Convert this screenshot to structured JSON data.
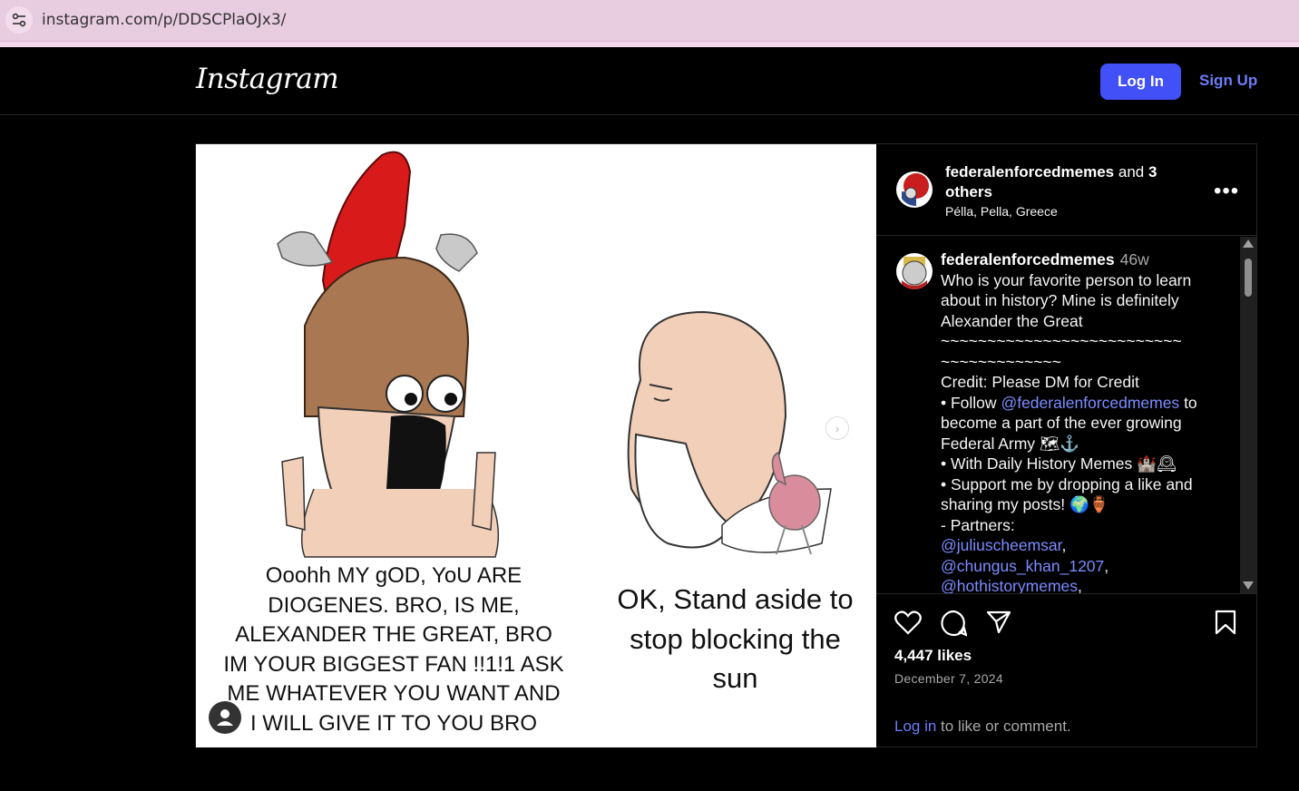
{
  "browser": {
    "url": "instagram.com/p/DDSCPlaOJx3/"
  },
  "header": {
    "logo": "Instagram",
    "login_label": "Log In",
    "signup_label": "Sign Up"
  },
  "media": {
    "caption_left": "Ooohh MY gOD, YoU ARE DIOGENES. BRO, IS ME, ALEXANDER THE GREAT, BRO IM YOUR BIGGEST FAN !!1!1 ASK ME WHATEVER YOU WANT AND I WILL GIVE IT TO YOU BRO",
    "caption_right": "OK, Stand aside to stop blocking the sun"
  },
  "post_header": {
    "username": "federalenforcedmemes",
    "and_text": "and",
    "others": "3 others",
    "location": "Pélla, Pella, Greece"
  },
  "caption": {
    "username": "federalenforcedmemes",
    "time_ago": "46w",
    "line1": "Who is your favorite person to learn about in history? Mine is definitely Alexander the Great",
    "tildes1": "~~~~~~~~~~~~~~~~~~~~~~~~~~",
    "tildes2": "~~~~~~~~~~~~~",
    "credit": "Credit: Please DM for Credit",
    "follow_prefix": "• Follow",
    "follow_mention": "@federalenforcedmemes",
    "follow_suffix": "to become a part of the ever growing Federal Army 🗺⚓",
    "daily": "• With Daily History Memes 🏰🕰",
    "support": "• Support me by dropping a like and sharing my posts! 🌍🏺",
    "partners": "- Partners:",
    "partner1": "@juliuscheemsar",
    "partner2": "@chungus_khan_1207",
    "partner3": "@hothistorymemes"
  },
  "engagement": {
    "likes": "4,447 likes",
    "date": "December 7, 2024",
    "login_link": "Log in",
    "login_suffix": " to like or comment."
  },
  "colors": {
    "accent": "#4150f7",
    "link": "#7b8cff",
    "background": "#000000"
  }
}
